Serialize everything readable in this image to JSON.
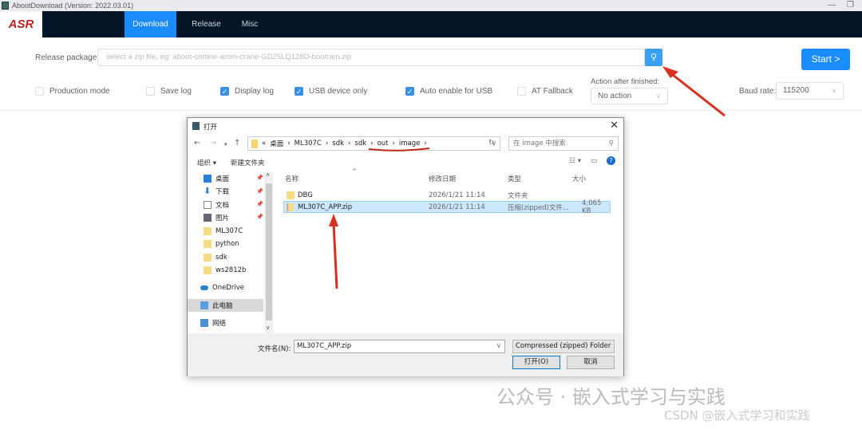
{
  "window": {
    "title": "AbootDownload (Version: 2022.03.01)",
    "minimize": "—",
    "restore": "❐"
  },
  "nav": {
    "logo": "ASR",
    "tabs": [
      {
        "label": "Download",
        "active": true
      },
      {
        "label": "Release"
      },
      {
        "label": "Misc"
      }
    ]
  },
  "form": {
    "release_label": "Release package:",
    "release_placeholder": "select a zip file, eg: aboot-cortexr-arom-crane-GD25LQ128D-bootram.zip",
    "search_icon": "⚲",
    "start_label": "Start  >",
    "checkboxes": [
      {
        "label": "Production mode",
        "checked": false
      },
      {
        "label": "Save log",
        "checked": false
      },
      {
        "label": "Display log",
        "checked": true
      },
      {
        "label": "USB device only",
        "checked": true
      },
      {
        "label": "Auto enable for USB",
        "checked": true
      },
      {
        "label": "AT Fallback",
        "checked": false
      }
    ],
    "action_label": "Action after finished:",
    "action_value": "No action",
    "baud_label": "Baud rate:",
    "baud_value": "115200"
  },
  "dialog": {
    "title": "打开",
    "close": "✕",
    "path": [
      "«",
      "桌面",
      "ML307C",
      "sdk",
      "sdk",
      "out",
      "image"
    ],
    "search_placeholder": "在 image 中搜索",
    "organize": "组织 ▾",
    "new_folder": "新建文件夹",
    "nav_items": [
      {
        "label": "桌面",
        "pinned": true
      },
      {
        "label": "下载",
        "pinned": true
      },
      {
        "label": "文档",
        "pinned": true
      },
      {
        "label": "图片",
        "pinned": true
      },
      {
        "label": "ML307C"
      },
      {
        "label": "python"
      },
      {
        "label": "sdk"
      },
      {
        "label": "ws2812b"
      },
      {
        "label": "OneDrive"
      },
      {
        "label": "此电脑",
        "selected": true
      },
      {
        "label": "网络"
      }
    ],
    "columns": [
      "名称",
      "修改日期",
      "类型",
      "大小"
    ],
    "files": [
      {
        "name": "DBG",
        "date": "2026/1/21 11:14",
        "type": "文件夹",
        "size": ""
      },
      {
        "name": "ML307C_APP.zip",
        "date": "2026/1/21 11:14",
        "type": "压缩(zipped)文件...",
        "size": "4,065 KB",
        "selected": true
      }
    ],
    "filename_label": "文件名(N):",
    "filename_value": "ML307C_APP.zip",
    "filetype": "Compressed (zipped) Folder",
    "open_label": "打开(O)",
    "cancel_label": "取消"
  },
  "watermark": {
    "line1": "公众号 · 嵌入式学习与实践",
    "line2": "CSDN @嵌入式学习和实践"
  },
  "colors": {
    "nav_bg": "#031527",
    "accent": "#1a8cff",
    "arrow": "#d9301f"
  }
}
